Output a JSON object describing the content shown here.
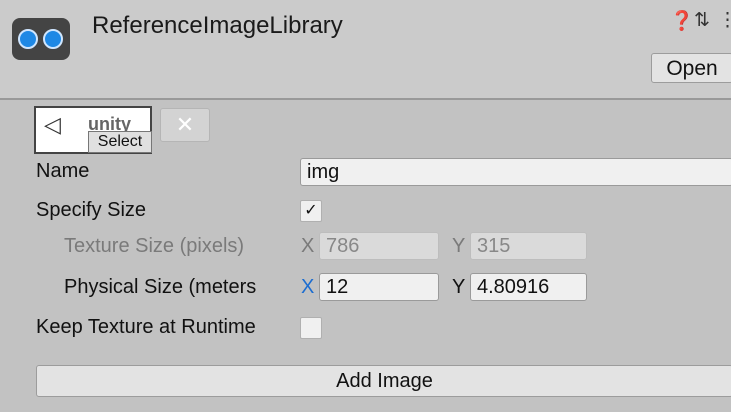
{
  "header": {
    "title": "ReferenceImageLibrary",
    "icons": [
      "help-icon",
      "preset-icon",
      "menu-icon"
    ],
    "help_glyph": "❓",
    "preset_glyph": "⇅",
    "menu_glyph": "⋮",
    "open_label": "Open"
  },
  "image_entry": {
    "thumbnail_logo": "◁",
    "thumbnail_text": "unity",
    "select_label": "Select",
    "remove_label": "✕"
  },
  "fields": {
    "name_label": "Name",
    "name_value": "img",
    "specify_size_label": "Specify Size",
    "specify_size_checked": "✓",
    "texture_size_label": "Texture Size (pixels)",
    "texture_x_label": "X",
    "texture_x_value": "786",
    "texture_y_label": "Y",
    "texture_y_value": "315",
    "physical_size_label": "Physical Size (meters",
    "physical_x_label": "X",
    "physical_x_value": "12",
    "physical_y_label": "Y",
    "physical_y_value": "4.80916",
    "keep_texture_label": "Keep Texture at Runtime",
    "keep_texture_checked": ""
  },
  "footer": {
    "add_image_label": "Add Image"
  },
  "colors": {
    "background": "#c2c2c2",
    "header": "#cbcbcb",
    "x_axis_accent": "#1c6dd0",
    "icon_lens": "#1e88e5"
  }
}
